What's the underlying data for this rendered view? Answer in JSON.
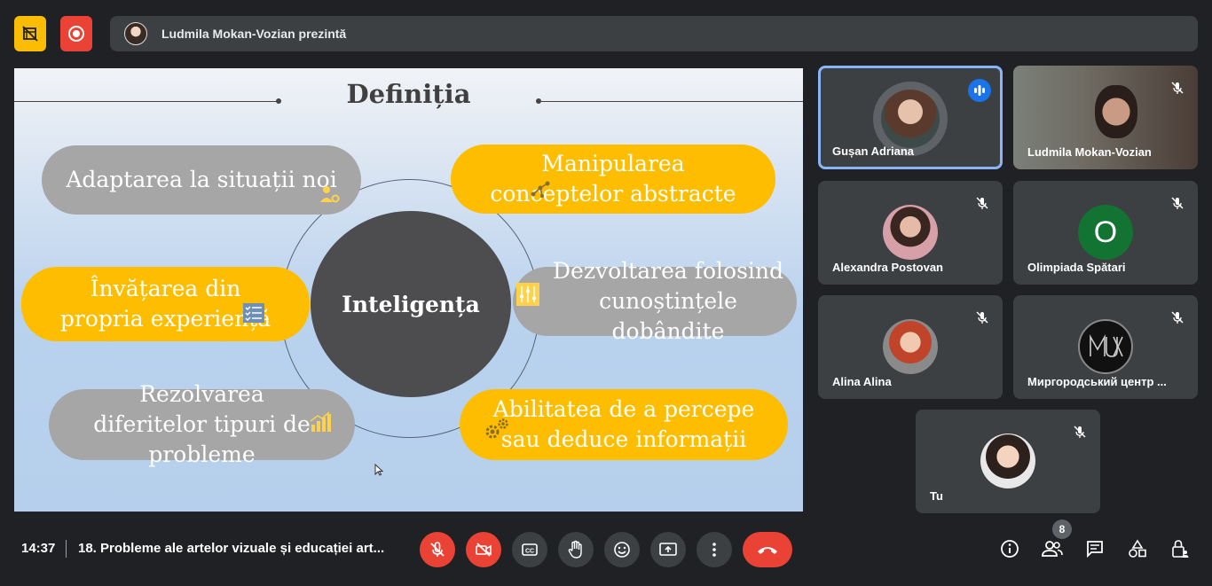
{
  "presenter_bar": {
    "text": "Ludmila Mokan-Vozian prezintă"
  },
  "slide": {
    "title": "Definiția",
    "center": "Inteligența",
    "items": [
      {
        "text": "Adaptarea la situații noi",
        "color": "gray",
        "icon": "user-gear-icon"
      },
      {
        "text": "Manipularea conceptelor abstracte",
        "color": "orange",
        "icon": "nodes-icon"
      },
      {
        "text": "Învățarea din propria experiență",
        "color": "orange",
        "icon": "checklist-icon"
      },
      {
        "text": "Dezvoltarea folosind cunoștințele dobândite",
        "color": "gray",
        "icon": "sliders-icon"
      },
      {
        "text": "Rezolvarea diferitelor tipuri de probleme",
        "color": "gray",
        "icon": "bar-chart-icon"
      },
      {
        "text": "Abilitatea de a percepe sau deduce informații",
        "color": "orange",
        "icon": "gears-icon"
      }
    ]
  },
  "participants": [
    {
      "name": "Gușan Adriana",
      "speaking": true
    },
    {
      "name": "Ludmila Mokan-Vozian",
      "muted": true
    },
    {
      "name": "Alexandra Postovan",
      "muted": true
    },
    {
      "name": "Olimpiada Spătari",
      "muted": true,
      "initial": "O"
    },
    {
      "name": "Alina Alina",
      "muted": true
    },
    {
      "name": "Миргородський центр ...",
      "muted": true
    },
    {
      "name": "Tu",
      "muted": true
    }
  ],
  "bottom": {
    "time": "14:37",
    "meeting_title": "18. Probleme ale artelor vizuale și educației art...",
    "participant_count": "8"
  },
  "colors": {
    "background": "#202124",
    "tile": "#3c4043",
    "red": "#ea4335",
    "yellow": "#fbbc04",
    "active_border": "#8ab4f8",
    "pill_gray": "#a6a6a6",
    "pill_orange": "#ffbd00"
  }
}
